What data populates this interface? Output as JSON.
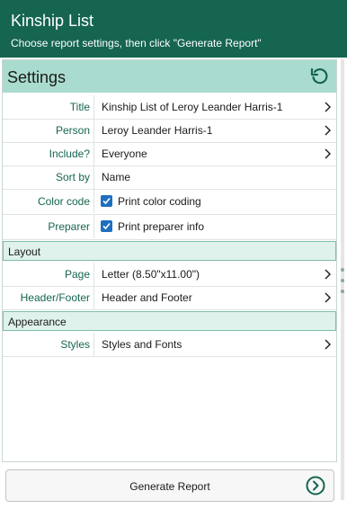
{
  "header": {
    "title": "Kinship List",
    "subtitle": "Choose report settings, then click \"Generate Report\""
  },
  "settings": {
    "heading": "Settings",
    "rows": [
      {
        "label": "Title",
        "value": "Kinship List of Leroy Leander Harris-1"
      },
      {
        "label": "Person",
        "value": "Leroy Leander Harris-1"
      },
      {
        "label": "Include?",
        "value": "Everyone"
      },
      {
        "label": "Sort by",
        "value": "Name"
      },
      {
        "label": "Color code",
        "value": "Print color coding",
        "checked": true
      },
      {
        "label": "Preparer",
        "value": "Print preparer info",
        "checked": true
      }
    ]
  },
  "layout": {
    "heading": "Layout",
    "rows": [
      {
        "label": "Page",
        "value": "Letter (8.50\"x11.00\")"
      },
      {
        "label": "Header/Footer",
        "value": "Header and Footer"
      }
    ]
  },
  "appearance": {
    "heading": "Appearance",
    "rows": [
      {
        "label": "Styles",
        "value": "Styles and Fonts"
      }
    ]
  },
  "footer": {
    "generate_label": "Generate Report"
  },
  "colors": {
    "header_bg": "#156551",
    "settings_bar": "#a9dccf",
    "section_bg": "#dff2ec",
    "label_text": "#156551",
    "checkbox": "#1f6fbf"
  }
}
